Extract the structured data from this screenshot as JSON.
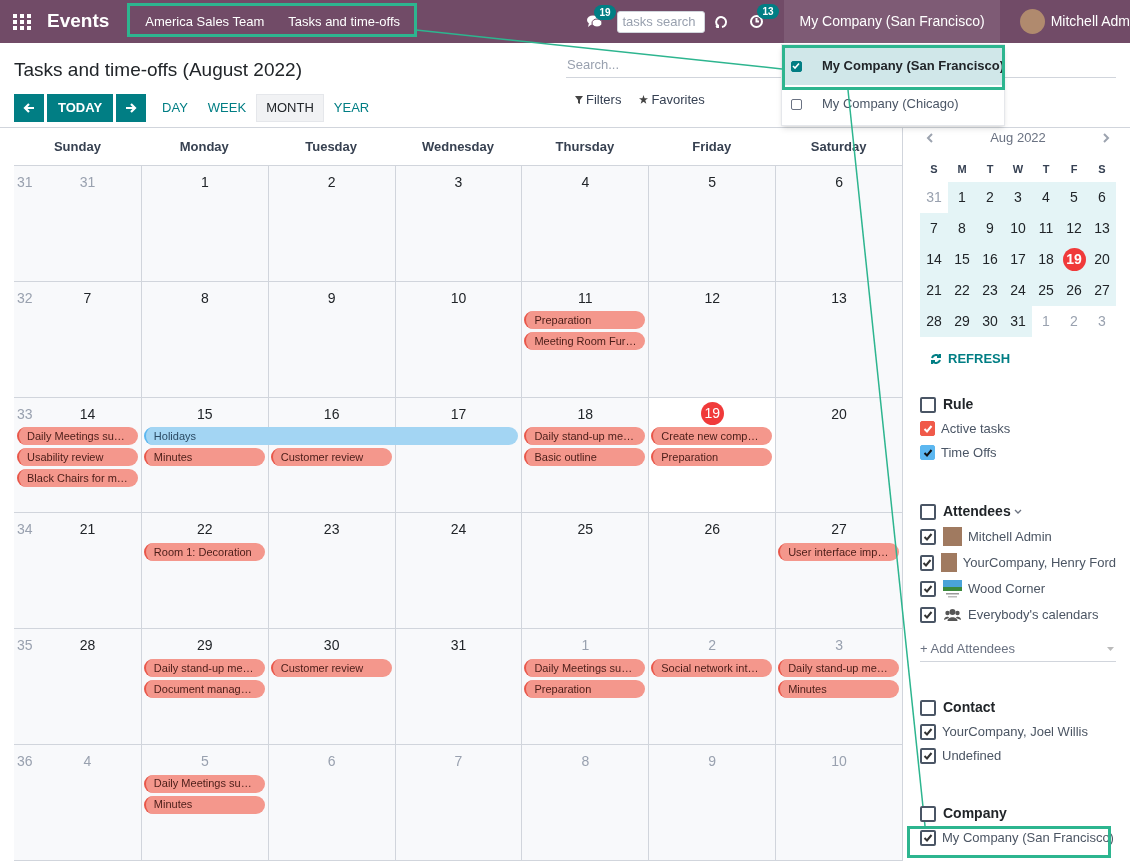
{
  "topbar": {
    "app": "Events",
    "breadcrumbs": [
      "America Sales Team",
      "Tasks and time-offs"
    ],
    "messages_badge": "19",
    "search_placeholder": "tasks search",
    "activities_badge": "13",
    "company": "My Company (San Francisco)",
    "user": "Mitchell Adm"
  },
  "company_menu": [
    {
      "label": "My Company (San Francisco)",
      "checked": true,
      "selected": true
    },
    {
      "label": "My Company (Chicago)",
      "checked": false,
      "selected": false
    }
  ],
  "title": "Tasks and time-offs (August 2022)",
  "today_button": "TODAY",
  "scales": [
    {
      "label": "DAY",
      "selected": false
    },
    {
      "label": "WEEK",
      "selected": false
    },
    {
      "label": "MONTH",
      "selected": true
    },
    {
      "label": "YEAR",
      "selected": false
    }
  ],
  "search": {
    "placeholder": "Search..."
  },
  "filters_label": "Filters",
  "favorites_label": "Favorites",
  "calendar": {
    "weekdays": [
      "Sunday",
      "Monday",
      "Tuesday",
      "Wednesday",
      "Thursday",
      "Friday",
      "Saturday"
    ],
    "weeks": [
      {
        "number": "31",
        "days": [
          {
            "day": "31",
            "other_month": true,
            "today": false
          },
          {
            "day": "1",
            "other_month": false,
            "today": false
          },
          {
            "day": "2",
            "other_month": false,
            "today": false
          },
          {
            "day": "3",
            "other_month": false,
            "today": false
          },
          {
            "day": "4",
            "other_month": false,
            "today": false
          },
          {
            "day": "5",
            "other_month": false,
            "today": false
          },
          {
            "day": "6",
            "other_month": false,
            "today": false
          }
        ]
      },
      {
        "number": "32",
        "days": [
          {
            "day": "7",
            "other_month": false,
            "today": false
          },
          {
            "day": "8",
            "other_month": false,
            "today": false
          },
          {
            "day": "9",
            "other_month": false,
            "today": false
          },
          {
            "day": "10",
            "other_month": false,
            "today": false
          },
          {
            "day": "11",
            "other_month": false,
            "today": false,
            "events": [
              {
                "title": "Preparation",
                "color": "#f4978c"
              },
              {
                "title": "Meeting Room Fur…",
                "color": "#f4978c"
              }
            ]
          },
          {
            "day": "12",
            "other_month": false,
            "today": false
          },
          {
            "day": "13",
            "other_month": false,
            "today": false
          }
        ]
      },
      {
        "number": "33",
        "days": [
          {
            "day": "14",
            "other_month": false,
            "today": false,
            "events": [
              {
                "title": "Daily Meetings su…",
                "color": "#f4978c"
              },
              {
                "title": "Usability review",
                "color": "#f4978c"
              },
              {
                "title": "Black Chairs for m…",
                "color": "#f4978c"
              }
            ]
          },
          {
            "day": "15",
            "other_month": false,
            "today": false,
            "events": [
              {
                "title": "Holidays",
                "color": "#a3d5f3"
              },
              {
                "title": "Minutes",
                "color": "#f4978c"
              }
            ]
          },
          {
            "day": "16",
            "other_month": false,
            "today": false,
            "covered": true,
            "events": [
              {
                "title": "Customer review",
                "color": "#f4978c"
              }
            ]
          },
          {
            "day": "17",
            "other_month": false,
            "today": false,
            "covered": true
          },
          {
            "day": "18",
            "other_month": false,
            "today": false,
            "events": [
              {
                "title": "Daily stand-up me…",
                "color": "#f4978c"
              },
              {
                "title": "Basic outline",
                "color": "#f4978c"
              }
            ]
          },
          {
            "day": "19",
            "other_month": false,
            "today": true,
            "events": [
              {
                "title": "Create new comp…",
                "color": "#f4978c"
              },
              {
                "title": "Preparation",
                "color": "#f4978c"
              }
            ]
          },
          {
            "day": "20",
            "other_month": false,
            "today": false
          }
        ]
      },
      {
        "number": "34",
        "days": [
          {
            "day": "21",
            "other_month": false,
            "today": false
          },
          {
            "day": "22",
            "other_month": false,
            "today": false,
            "events": [
              {
                "title": "Room 1: Decoration",
                "color": "#f4978c"
              }
            ]
          },
          {
            "day": "23",
            "other_month": false,
            "today": false
          },
          {
            "day": "24",
            "other_month": false,
            "today": false
          },
          {
            "day": "25",
            "other_month": false,
            "today": false
          },
          {
            "day": "26",
            "other_month": false,
            "today": false
          },
          {
            "day": "27",
            "other_month": false,
            "today": false,
            "events": [
              {
                "title": "User interface imp…",
                "color": "#f4978c"
              }
            ]
          }
        ]
      },
      {
        "number": "35",
        "days": [
          {
            "day": "28",
            "other_month": false,
            "today": false
          },
          {
            "day": "29",
            "other_month": false,
            "today": false,
            "events": [
              {
                "title": "Daily stand-up me…",
                "color": "#f4978c"
              },
              {
                "title": "Document manag…",
                "color": "#f4978c"
              }
            ]
          },
          {
            "day": "30",
            "other_month": false,
            "today": false,
            "events": [
              {
                "title": "Customer review",
                "color": "#f4978c"
              }
            ]
          },
          {
            "day": "31",
            "other_month": false,
            "today": false
          },
          {
            "day": "1",
            "other_month": true,
            "today": false,
            "events": [
              {
                "title": "Daily Meetings su…",
                "color": "#f4978c"
              },
              {
                "title": "Preparation",
                "color": "#f4978c"
              }
            ]
          },
          {
            "day": "2",
            "other_month": true,
            "today": false,
            "events": [
              {
                "title": "Social network int…",
                "color": "#f4978c"
              }
            ]
          },
          {
            "day": "3",
            "other_month": true,
            "today": false,
            "events": [
              {
                "title": "Daily stand-up me…",
                "color": "#f4978c"
              },
              {
                "title": "Minutes",
                "color": "#f4978c"
              }
            ]
          }
        ]
      },
      {
        "number": "36",
        "days": [
          {
            "day": "4",
            "other_month": true,
            "today": false
          },
          {
            "day": "5",
            "other_month": true,
            "today": false,
            "events": [
              {
                "title": "Daily Meetings su…",
                "color": "#f4978c"
              },
              {
                "title": "Minutes",
                "color": "#f4978c"
              }
            ]
          },
          {
            "day": "6",
            "other_month": true,
            "today": false
          },
          {
            "day": "7",
            "other_month": true,
            "today": false
          },
          {
            "day": "8",
            "other_month": true,
            "today": false
          },
          {
            "day": "9",
            "other_month": true,
            "today": false
          },
          {
            "day": "10",
            "other_month": true,
            "today": false
          }
        ]
      }
    ]
  },
  "mini_calendar": {
    "title": "Aug 2022",
    "weekdays": [
      "S",
      "M",
      "T",
      "W",
      "T",
      "F",
      "S"
    ],
    "weeks": [
      [
        {
          "day": "31",
          "other_month": true,
          "today": false
        },
        {
          "day": "1",
          "other_month": false,
          "today": false
        },
        {
          "day": "2",
          "other_month": false,
          "today": false
        },
        {
          "day": "3",
          "other_month": false,
          "today": false
        },
        {
          "day": "4",
          "other_month": false,
          "today": false
        },
        {
          "day": "5",
          "other_month": false,
          "today": false
        },
        {
          "day": "6",
          "other_month": false,
          "today": false
        }
      ],
      [
        {
          "day": "7",
          "other_month": false,
          "today": false
        },
        {
          "day": "8",
          "other_month": false,
          "today": false
        },
        {
          "day": "9",
          "other_month": false,
          "today": false
        },
        {
          "day": "10",
          "other_month": false,
          "today": false
        },
        {
          "day": "11",
          "other_month": false,
          "today": false
        },
        {
          "day": "12",
          "other_month": false,
          "today": false
        },
        {
          "day": "13",
          "other_month": false,
          "today": false
        }
      ],
      [
        {
          "day": "14",
          "other_month": false,
          "today": false
        },
        {
          "day": "15",
          "other_month": false,
          "today": false
        },
        {
          "day": "16",
          "other_month": false,
          "today": false
        },
        {
          "day": "17",
          "other_month": false,
          "today": false
        },
        {
          "day": "18",
          "other_month": false,
          "today": false
        },
        {
          "day": "19",
          "other_month": false,
          "today": true
        },
        {
          "day": "20",
          "other_month": false,
          "today": false
        }
      ],
      [
        {
          "day": "21",
          "other_month": false,
          "today": false
        },
        {
          "day": "22",
          "other_month": false,
          "today": false
        },
        {
          "day": "23",
          "other_month": false,
          "today": false
        },
        {
          "day": "24",
          "other_month": false,
          "today": false
        },
        {
          "day": "25",
          "other_month": false,
          "today": false
        },
        {
          "day": "26",
          "other_month": false,
          "today": false
        },
        {
          "day": "27",
          "other_month": false,
          "today": false
        }
      ],
      [
        {
          "day": "28",
          "other_month": false,
          "today": false
        },
        {
          "day": "29",
          "other_month": false,
          "today": false
        },
        {
          "day": "30",
          "other_month": false,
          "today": false
        },
        {
          "day": "31",
          "other_month": false,
          "today": false
        },
        {
          "day": "1",
          "other_month": true,
          "today": false
        },
        {
          "day": "2",
          "other_month": true,
          "today": false
        },
        {
          "day": "3",
          "other_month": true,
          "today": false
        }
      ]
    ]
  },
  "refresh": "REFRESH",
  "filter_groups": [
    {
      "title": "Rule",
      "checked": false,
      "collapsible": false,
      "items": [
        {
          "label": "Active tasks",
          "checked": true,
          "kind": "plain",
          "color": "#f05a4a"
        },
        {
          "label": "Time Offs",
          "checked": true,
          "kind": "plain",
          "color": "#5cb7f0"
        }
      ]
    },
    {
      "title": "Attendees",
      "checked": false,
      "collapsible": true,
      "add_placeholder": "+ Add Attendees",
      "items": [
        {
          "label": "Mitchell Admin",
          "checked": true,
          "kind": "avatar"
        },
        {
          "label": "YourCompany, Henry Ford",
          "checked": true,
          "kind": "avatar"
        },
        {
          "label": "Wood Corner",
          "checked": true,
          "kind": "logo"
        },
        {
          "label": "Everybody's calendars",
          "checked": true,
          "kind": "group"
        }
      ]
    },
    {
      "title": "Contact",
      "checked": false,
      "collapsible": false,
      "items": [
        {
          "label": "YourCompany, Joel Willis",
          "checked": true,
          "kind": "plain"
        },
        {
          "label": "Undefined",
          "checked": true,
          "kind": "plain"
        }
      ]
    },
    {
      "title": "Company",
      "checked": false,
      "collapsible": false,
      "items": [
        {
          "label": "My Company (San Francisco)",
          "checked": true,
          "kind": "plain"
        }
      ]
    }
  ]
}
